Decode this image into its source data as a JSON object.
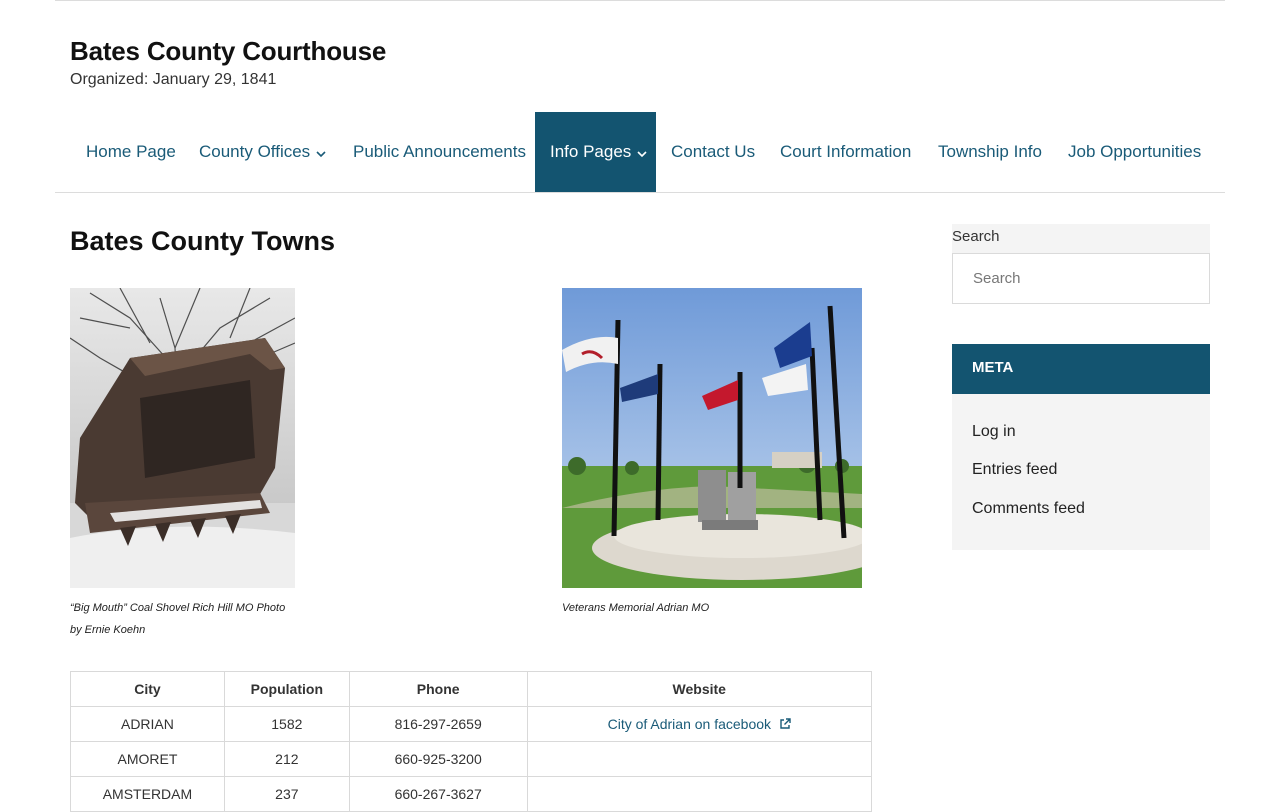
{
  "site": {
    "title": "Bates County Courthouse",
    "description": "Organized: January 29, 1841"
  },
  "nav": {
    "items": [
      {
        "label": "Home Page"
      },
      {
        "label": "County Offices"
      },
      {
        "label": "Public Announcements"
      },
      {
        "label": "Info Pages"
      },
      {
        "label": "Contact Us"
      },
      {
        "label": "Court Information"
      },
      {
        "label": "Township Info"
      },
      {
        "label": "Job Opportunities"
      }
    ],
    "active": "Info Pages"
  },
  "page": {
    "title": "Bates County Towns"
  },
  "photos": [
    {
      "caption_line1": "“Big Mouth” Coal Shovel Rich Hill MO Photo",
      "caption_line2": "by Ernie Koehn"
    },
    {
      "caption_line1": "Veterans Memorial Adrian MO"
    }
  ],
  "table": {
    "headers": [
      "City",
      "Population",
      "Phone",
      "Website"
    ],
    "rows": [
      {
        "city": "ADRIAN",
        "population": "1582",
        "phone": "816-297-2659",
        "website": "City of Adrian on facebook"
      },
      {
        "city": "AMORET",
        "population": "212",
        "phone": "660-925-3200",
        "website": ""
      },
      {
        "city": "AMSTERDAM",
        "population": "237",
        "phone": "660-267-3627",
        "website": ""
      }
    ]
  },
  "sidebar": {
    "search_label": "Search",
    "search_placeholder": "Search",
    "meta_title": "META",
    "meta_links": [
      "Log in",
      "Entries feed",
      "Comments feed"
    ]
  },
  "colors": {
    "brand": "#135470",
    "link": "#1a5b78",
    "panel": "#f4f4f4"
  }
}
